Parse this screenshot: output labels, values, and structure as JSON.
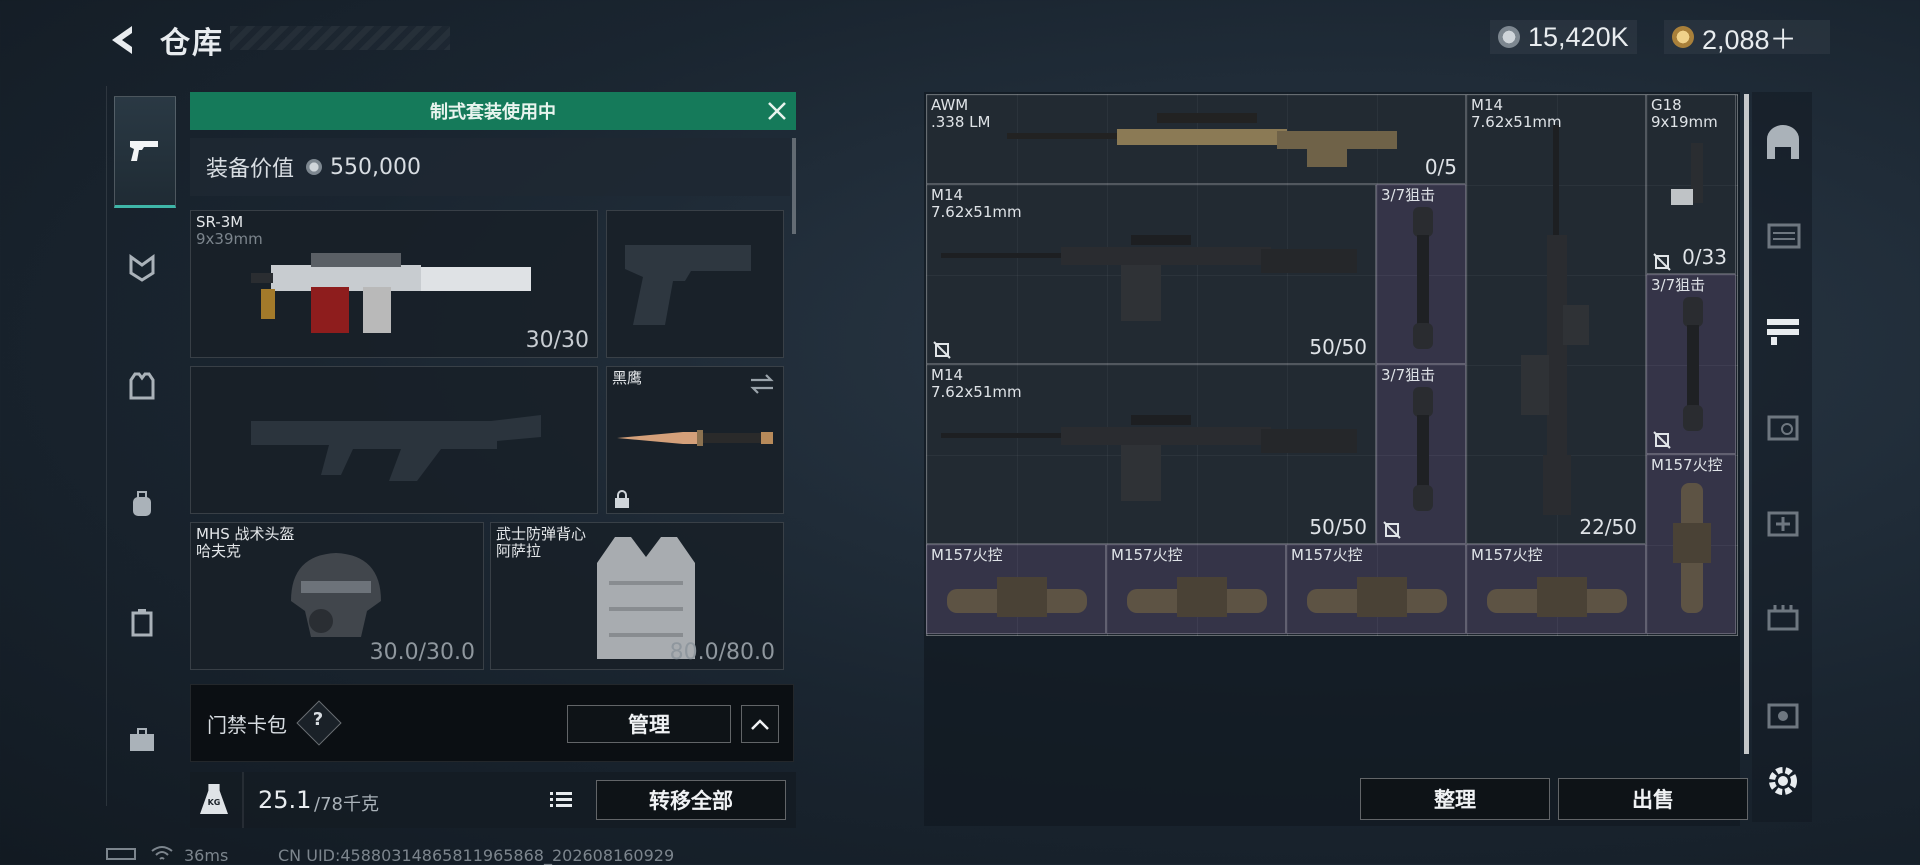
{
  "header": {
    "title": "仓库",
    "currency_silver": "15,420K",
    "currency_gold": "2,088＋"
  },
  "left_tabs": [
    "pistol-icon",
    "mask-icon",
    "vest-icon",
    "backpack-icon",
    "container-icon",
    "toolbox-icon"
  ],
  "loadout": {
    "banner": "制式套装使用中",
    "value_label": "装备价值",
    "value": "550,000",
    "primary": {
      "name": "SR-3M",
      "ammo": "9x39mm",
      "count": "30/30"
    },
    "melee": {
      "name": "黑鹰"
    },
    "helmet": {
      "name": "MHS 战术头盔",
      "sub": "哈夫克",
      "durability": "30.0/30.0"
    },
    "armor": {
      "name": "武士防弹背心",
      "sub": "阿萨拉",
      "durability": "80.0/80.0"
    },
    "keycard_label": "门禁卡包",
    "help": "?",
    "manage": "管理",
    "weight": "25.1",
    "weight_max": "/78千克",
    "weight_icon": "KG",
    "transfer_all": "转移全部"
  },
  "inventory": {
    "items": [
      {
        "name": "AWM",
        "sub": ".338 LM",
        "count": "0/5"
      },
      {
        "name": "M14",
        "sub": "7.62x51mm",
        "count": "22/50"
      },
      {
        "name": "G18",
        "sub": "9x19mm",
        "count": "0/33"
      },
      {
        "name": "M14",
        "sub": "7.62x51mm",
        "count": "50/50"
      },
      {
        "name": "3/7狙击"
      },
      {
        "name": "M14",
        "sub": "7.62x51mm",
        "count": "50/50"
      },
      {
        "name": "3/7狙击"
      },
      {
        "name": "3/7狙击"
      },
      {
        "name": "M157火控"
      },
      {
        "name": "M157火控"
      },
      {
        "name": "M157火控"
      },
      {
        "name": "M157火控"
      },
      {
        "name": "M157火控"
      }
    ],
    "sort": "整理",
    "sell": "出售"
  },
  "status": {
    "ping": "36ms",
    "uid": "CN UID:458803148658119658​68_202608160929"
  }
}
